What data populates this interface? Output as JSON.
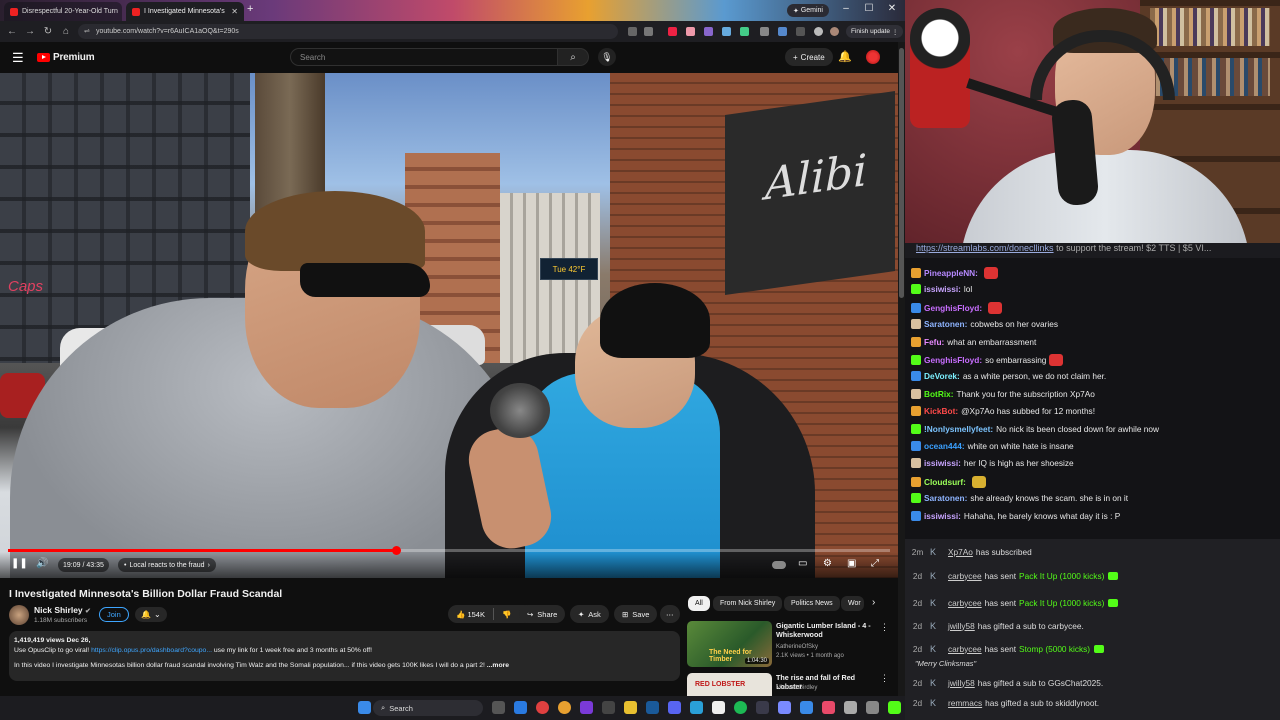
{
  "browser": {
    "tabs": [
      {
        "label": "Disrespectful 20-Year-Old Turn"
      },
      {
        "label": "I Investigated Minnesota's"
      }
    ],
    "gemini_label": "Gemini",
    "url": "youtube.com/watch?v=r6AuICA1aOQ&t=290s",
    "finish_update_label": "Finish update"
  },
  "youtube": {
    "logo_text": "Premium",
    "search_placeholder": "Search",
    "create_label": "Create",
    "player": {
      "time": "19:09 / 43:35",
      "chapter": "Local reacts to the fraud",
      "progress_fraction": 0.44
    },
    "video": {
      "title": "I Investigated Minnesota's Billion Dollar Fraud Scandal",
      "channel": "Nick Shirley",
      "subscribers": "1.18M subscribers",
      "join_label": "Join",
      "likes": "154K",
      "share_label": "Share",
      "ask_label": "Ask",
      "save_label": "Save",
      "sign_text": "Tue 42°F",
      "storefront_text": "Alibi",
      "street_sign": "Caps"
    },
    "description": {
      "stats": "1,419,419 views  Dec 26,",
      "line1_prefix": "Use OpusClip to go viral!",
      "line1_link": "https://clip.opus.pro/dashboard?coupo...",
      "line1_suffix": "use my link for 1 week free and 3 months at 50% off!",
      "line2": "In this video I investigate Minnesotas billion dollar fraud scandal involving Tim Walz and the Somali population... if this video gets 100K likes I will do a part 2!",
      "more": "...more"
    },
    "chips": [
      "All",
      "From Nick Shirley",
      "Politics News",
      "Wor"
    ],
    "recommendations": [
      {
        "title": "Gigantic Lumber Island - 4 - Whiskerwood",
        "channel": "KatherineOfSky",
        "meta": "2.1K views • 1 month ago",
        "duration": "1:04:30",
        "thumb_text": "The Need for Timber"
      },
      {
        "title": "The rise and fall of Red Lobster",
        "channel": "Michael Girdley",
        "meta": "",
        "duration": "",
        "thumb_text": "RED LOBSTER"
      }
    ]
  },
  "taskbar": {
    "search_label": "Search"
  },
  "chat": {
    "top_link": "https://streamlabs.com/donecllinks",
    "top_suffix": "to support the stream! $2 TTS | $5 VI...",
    "messages": [
      {
        "user": "PineappleNN:",
        "color": "#b689ff",
        "text": ""
      },
      {
        "user": "issiwissi:",
        "color": "#c8a4ff",
        "text": "lol"
      },
      {
        "user": "GenghisFloyd:",
        "color": "#c86eff",
        "text": ""
      },
      {
        "user": "Saratonen:",
        "color": "#8eb4ff",
        "text": "cobwebs on her ovaries"
      },
      {
        "user": "Fefu:",
        "color": "#e88aff",
        "text": "what an embarrassment"
      },
      {
        "user": "GenghisFloyd:",
        "color": "#c86eff",
        "text": "so embarrassing"
      },
      {
        "user": "DeVorek:",
        "color": "#7cf0ff",
        "text": "as a white person, we do not claim her."
      },
      {
        "user": "BotRix:",
        "color": "#53fc18",
        "text": "Thank you for the subscription Xp7Ao"
      },
      {
        "user": "KickBot:",
        "color": "#ff4a4a",
        "text": "@Xp7Ao has subbed for 12 months!"
      },
      {
        "user": "!Nonlysmellyfeet:",
        "color": "#7cc4ff",
        "text": "No nick its been closed down for awhile now"
      },
      {
        "user": "ocean444:",
        "color": "#3aa0ff",
        "text": "white on white hate is insane"
      },
      {
        "user": "issiwissi:",
        "color": "#c8a4ff",
        "text": "her IQ is high as her shoesize"
      },
      {
        "user": "Cloudsurf:",
        "color": "#9cff5a",
        "text": ""
      },
      {
        "user": "Saratonen:",
        "color": "#8eb4ff",
        "text": "she already knows the scam. she is in on it"
      },
      {
        "user": "issiwissi:",
        "color": "#c8a4ff",
        "text": "Hahaha, he barely knows what day it is : P"
      }
    ]
  },
  "events": [
    {
      "time": "2m",
      "user": "Xp7Ao",
      "action": "has subscribed",
      "gift": "",
      "quote": ""
    },
    {
      "time": "2d",
      "user": "carbycee",
      "action": "has sent",
      "gift": "Pack It Up (1000 kicks)",
      "quote": ""
    },
    {
      "time": "2d",
      "user": "carbycee",
      "action": "has sent",
      "gift": "Pack It Up (1000 kicks)",
      "quote": ""
    },
    {
      "time": "2d",
      "user": "jwilly58",
      "action": "has gifted a sub to carbycee.",
      "gift": "",
      "quote": ""
    },
    {
      "time": "2d",
      "user": "carbycee",
      "action": "has sent",
      "gift": "Stomp (5000 kicks)",
      "quote": "\"Merry Clinksmas\""
    },
    {
      "time": "2d",
      "user": "jwilly58",
      "action": "has gifted a sub to GGsChat2025.",
      "gift": "",
      "quote": ""
    },
    {
      "time": "2d",
      "user": "remmacs",
      "action": "has gifted a sub to skiddlynoot.",
      "gift": "",
      "quote": ""
    }
  ]
}
